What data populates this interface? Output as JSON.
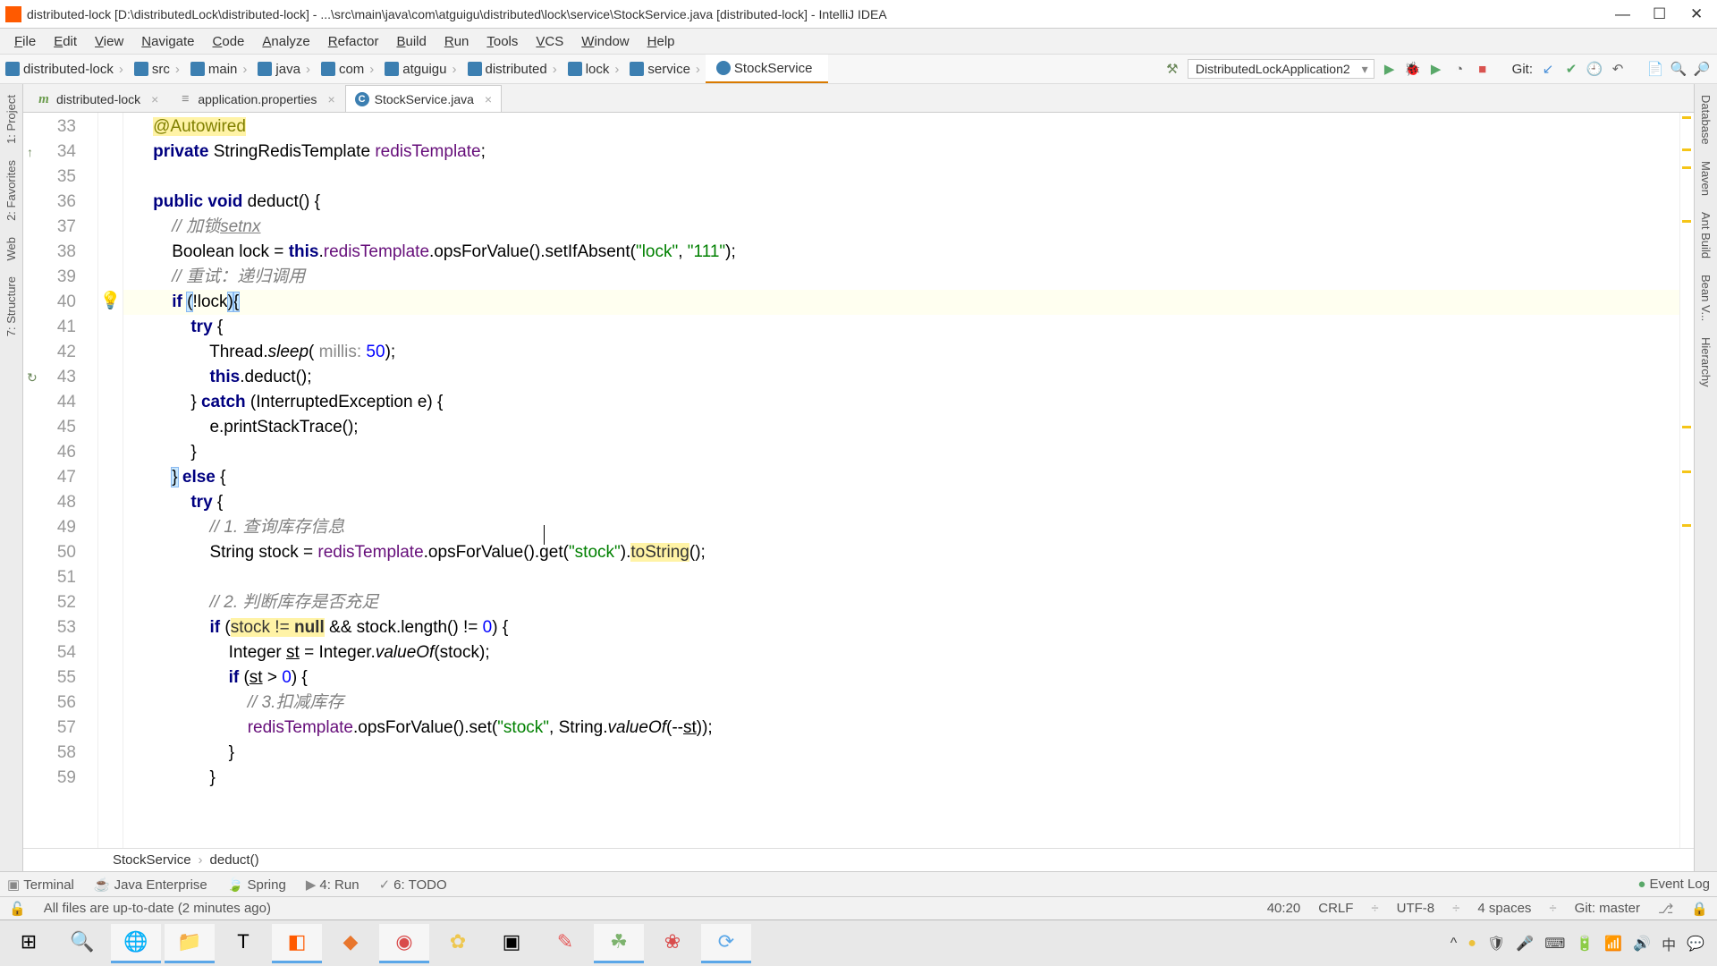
{
  "title": "distributed-lock [D:\\distributedLock\\distributed-lock] - ...\\src\\main\\java\\com\\atguigu\\distributed\\lock\\service\\StockService.java [distributed-lock] - IntelliJ IDEA",
  "menu": [
    "File",
    "Edit",
    "View",
    "Navigate",
    "Code",
    "Analyze",
    "Refactor",
    "Build",
    "Run",
    "Tools",
    "VCS",
    "Window",
    "Help"
  ],
  "crumbs": [
    "distributed-lock",
    "src",
    "main",
    "java",
    "com",
    "atguigu",
    "distributed",
    "lock",
    "service",
    "StockService"
  ],
  "runConfig": "DistributedLockApplication2",
  "gitLabel": "Git:",
  "tabs": [
    {
      "label": "distributed-lock",
      "type": "m",
      "active": false
    },
    {
      "label": "application.properties",
      "type": "p",
      "active": false
    },
    {
      "label": "StockService.java",
      "type": "c",
      "active": true
    }
  ],
  "leftBars": [
    "1: Project",
    "2: Favorites",
    "Web",
    "7: Structure"
  ],
  "rightBars": [
    "Database",
    "Maven",
    "Ant Build",
    "Bean V...",
    "Hierarchy"
  ],
  "bottomTools": [
    "Terminal",
    "Java Enterprise",
    "Spring",
    "4: Run",
    "6: TODO"
  ],
  "bottomRight": "Event Log",
  "statusLeft": "All files are up-to-date (2 minutes ago)",
  "statusRight": [
    "40:20",
    "CRLF",
    "UTF-8",
    "4 spaces",
    "Git: master"
  ],
  "breadcrumbBottom": [
    "StockService",
    "deduct()"
  ],
  "code": {
    "start": 33,
    "lines": [
      {
        "n": 33,
        "cls": "",
        "html": "    <span class='ann'>@Autowired</span>"
      },
      {
        "n": 34,
        "cls": "",
        "html": "    <span class='kw'>private</span> StringRedisTemplate <span class='fld'>redisTemplate</span>;"
      },
      {
        "n": 35,
        "cls": "",
        "html": ""
      },
      {
        "n": 36,
        "cls": "",
        "html": "    <span class='kw'>public void</span> deduct() {"
      },
      {
        "n": 37,
        "cls": "",
        "html": "        <span class='cmt'>// 加锁<u>setnx</u></span>"
      },
      {
        "n": 38,
        "cls": "",
        "html": "        Boolean lock = <span class='kw'>this</span>.<span class='fld'>redisTemplate</span>.opsForValue().setIfAbsent(<span class='str'>\"lock\"</span>, <span class='str'>\"111\"</span>);"
      },
      {
        "n": 39,
        "cls": "",
        "html": "        <span class='cmt'>// 重试：递归调用</span>"
      },
      {
        "n": 40,
        "cls": "hl",
        "html": "        <span class='kw'>if</span> <span class='brace-match'>(</span>!lock<span class='brace-match'>)</span><span class='brace-match'>{</span><span class='caret'></span>"
      },
      {
        "n": 41,
        "cls": "",
        "html": "            <span class='kw'>try</span> {"
      },
      {
        "n": 42,
        "cls": "",
        "html": "                Thread.<span class='mth'>sleep</span>( <span class='param'>millis:</span> <span class='num'>50</span>);"
      },
      {
        "n": 43,
        "cls": "",
        "html": "                <span class='kw'>this</span>.deduct();"
      },
      {
        "n": 44,
        "cls": "",
        "html": "            } <span class='kw'>catch</span> (InterruptedException e) {"
      },
      {
        "n": 45,
        "cls": "",
        "html": "                e.printStackTrace();"
      },
      {
        "n": 46,
        "cls": "",
        "html": "            }"
      },
      {
        "n": 47,
        "cls": "",
        "html": "        <span class='brace-match'>}</span> <span class='kw'>else</span> {"
      },
      {
        "n": 48,
        "cls": "",
        "html": "            <span class='kw'>try</span> {"
      },
      {
        "n": 49,
        "cls": "",
        "html": "                <span class='cmt'>// 1. 查询库存信息</span>"
      },
      {
        "n": 50,
        "cls": "",
        "html": "                String stock = <span class='fld'>redisTemplate</span>.opsForValue().get(<span class='str'>\"stock\"</span>).<span class='warn'>toString</span>();"
      },
      {
        "n": 51,
        "cls": "",
        "html": ""
      },
      {
        "n": 52,
        "cls": "",
        "html": "                <span class='cmt'>// 2. 判断库存是否充足</span>"
      },
      {
        "n": 53,
        "cls": "",
        "html": "                <span class='kw'>if</span> (<span class='warn'>stock != <b>null</b></span> && stock.length() != <span class='num'>0</span>) {"
      },
      {
        "n": 54,
        "cls": "",
        "html": "                    Integer <u>st</u> = Integer.<span class='mth'>valueOf</span>(stock);"
      },
      {
        "n": 55,
        "cls": "",
        "html": "                    <span class='kw'>if</span> (<u>st</u> > <span class='num'>0</span>) {"
      },
      {
        "n": 56,
        "cls": "",
        "html": "                        <span class='cmt'>// 3.扣减库存</span>"
      },
      {
        "n": 57,
        "cls": "",
        "html": "                        <span class='fld'>redisTemplate</span>.opsForValue().set(<span class='str'>\"stock\"</span>, String.<span class='mth'>valueOf</span>(--<u>st</u>));"
      },
      {
        "n": 58,
        "cls": "",
        "html": "                    }"
      },
      {
        "n": 59,
        "cls": "",
        "html": "                }"
      }
    ]
  },
  "gutterIcons": {
    "34": "↑",
    "43": "↻"
  },
  "lineIcons": {
    "40": "💡"
  }
}
